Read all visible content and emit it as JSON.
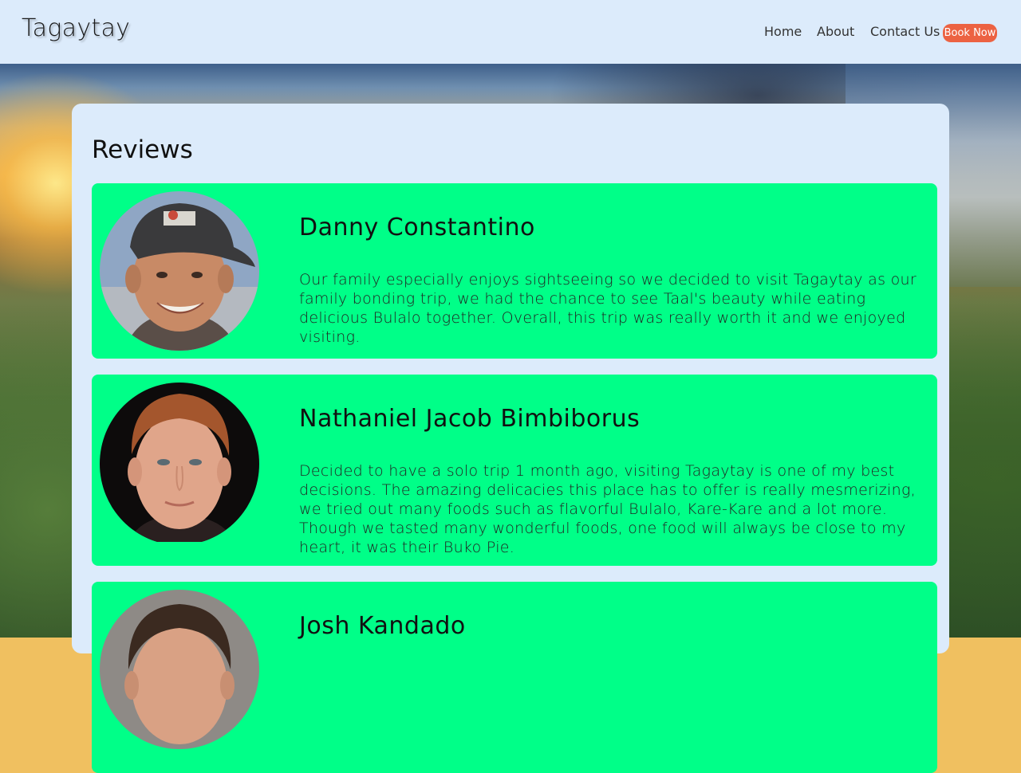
{
  "navbar": {
    "brand": "Tagaytay",
    "links": [
      {
        "label": "Home"
      },
      {
        "label": "About"
      },
      {
        "label": "Contact Us"
      }
    ],
    "cta_label": "Book Now"
  },
  "reviews": {
    "title": "Reviews",
    "items": [
      {
        "name": "Danny Constantino",
        "text": "Our family especially enjoys sightseeing so we decided to visit Tagaytay as our family bonding trip, we had the chance to see Taal's beauty while eating delicious Bulalo together. Overall, this trip was really worth it and we enjoyed visiting."
      },
      {
        "name": "Nathaniel Jacob Bimbiborus",
        "text": "Decided to have a solo trip 1 month ago, visiting Tagaytay is one of my best decisions. The amazing delicacies this place has to offer is really mesmerizing, we tried out many foods such as flavorful Bulalo, Kare-Kare and a lot more. Though we tasted many wonderful foods, one food will always be close to my heart, it was their Buko Pie."
      },
      {
        "name": "Josh Kandado",
        "text": ""
      }
    ]
  },
  "colors": {
    "nav_bg": "#dcebfb",
    "card_bg": "#00ff88",
    "cta_bg": "#ec6242"
  }
}
